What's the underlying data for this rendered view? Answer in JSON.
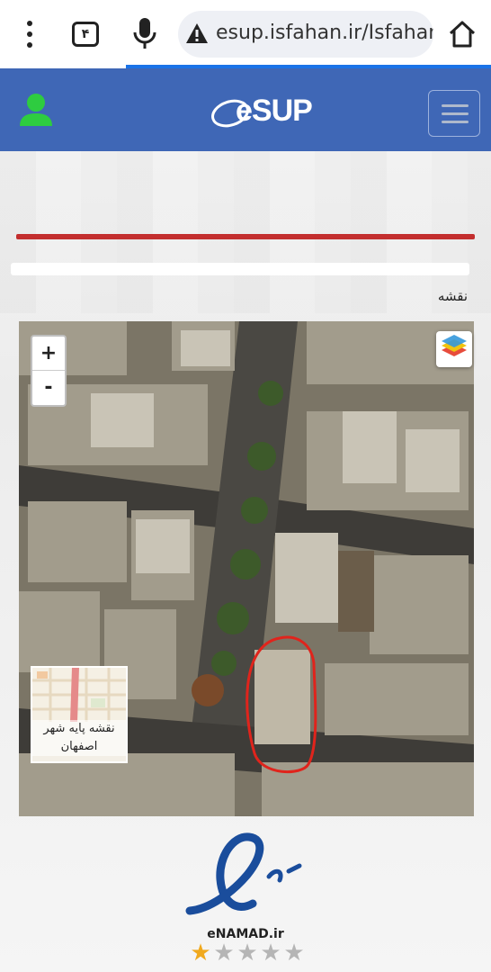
{
  "browser": {
    "tab_count": "۴",
    "url": "esup.isfahan.ir/Isfahan",
    "icons": [
      "menu-dots-icon",
      "tab-count-icon",
      "microphone-icon",
      "warning-icon",
      "home-icon"
    ]
  },
  "header": {
    "brand": "eSUP",
    "brand_color": "#3f67b6",
    "icons": [
      "user-icon",
      "hamburger-menu-icon"
    ]
  },
  "main": {
    "map_label": "نقشه",
    "zoom_in": "+",
    "zoom_out": "-",
    "basemap_caption": "نقشه پایه شهر اصفهان"
  },
  "footer": {
    "enamad_text": "eNAMAD.ir",
    "rating": 1,
    "rating_max": 5
  }
}
